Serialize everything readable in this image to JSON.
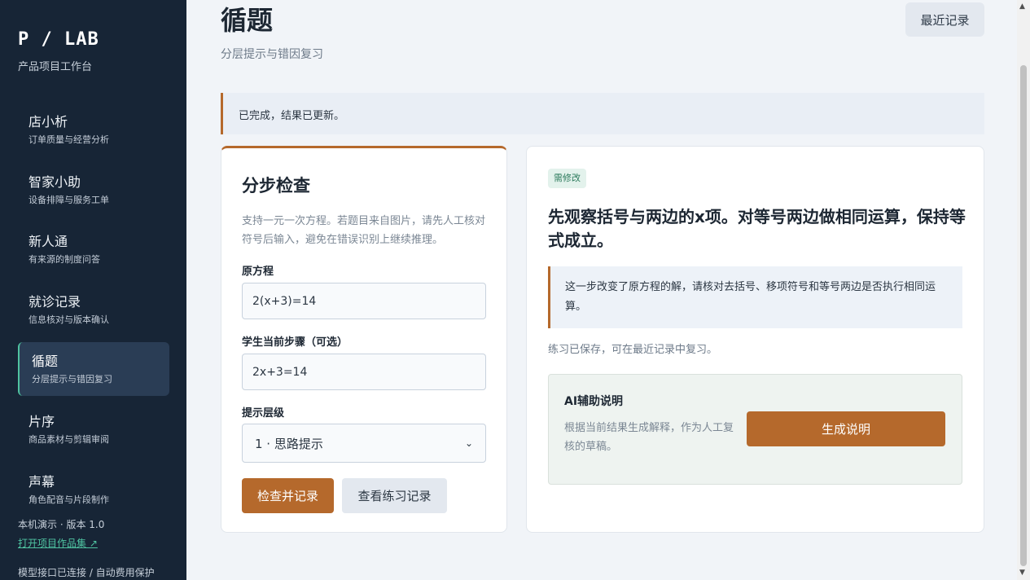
{
  "sidebar": {
    "logo": "P / LAB",
    "subtitle": "产品项目工作台",
    "items": [
      {
        "title": "店小析",
        "sub": "订单质量与经营分析"
      },
      {
        "title": "智家小助",
        "sub": "设备排障与服务工单"
      },
      {
        "title": "新人通",
        "sub": "有来源的制度问答"
      },
      {
        "title": "就诊记录",
        "sub": "信息核对与版本确认"
      },
      {
        "title": "循题",
        "sub": "分层提示与错因复习"
      },
      {
        "title": "片序",
        "sub": "商品素材与剪辑审阅"
      },
      {
        "title": "声幕",
        "sub": "角色配音与片段制作"
      }
    ],
    "active_index": 4,
    "version": "本机演示 · 版本 1.0",
    "portfolio_link": "打开项目作品集 ↗",
    "status": "模型接口已连接 / 自动费用保护"
  },
  "header": {
    "title": "循题",
    "subtitle": "分层提示与错因复习",
    "recent_button": "最近记录"
  },
  "alert": {
    "text": "已完成，结果已更新。"
  },
  "check_card": {
    "title": "分步检查",
    "description": "支持一元一次方程。若题目来自图片，请先人工核对符号后输入，避免在错误识别上继续推理。",
    "equation_label": "原方程",
    "equation_value": "2(x+3)=14",
    "step_label": "学生当前步骤（可选）",
    "step_value": "2x+3=14",
    "hint_label": "提示层级",
    "hint_value": "1 · 思路提示",
    "submit_button": "检查并记录",
    "history_button": "查看练习记录"
  },
  "result_card": {
    "badge": "需修改",
    "title": "先观察括号与两边的x项。对等号两边做相同运算，保持等式成立。",
    "note": "这一步改变了原方程的解，请核对去括号、移项符号和等号两边是否执行相同运算。",
    "saved_text": "练习已保存，可在最近记录中复习。",
    "ai_title": "AI辅助说明",
    "ai_description": "根据当前结果生成解释，作为人工复核的草稿。",
    "ai_button": "生成说明"
  },
  "colors": {
    "sidebar_bg": "#172536",
    "accent": "#b5692c",
    "active_marker": "#4fc3a1",
    "badge_bg": "#e3f2ec",
    "badge_text": "#2c7a5c"
  }
}
